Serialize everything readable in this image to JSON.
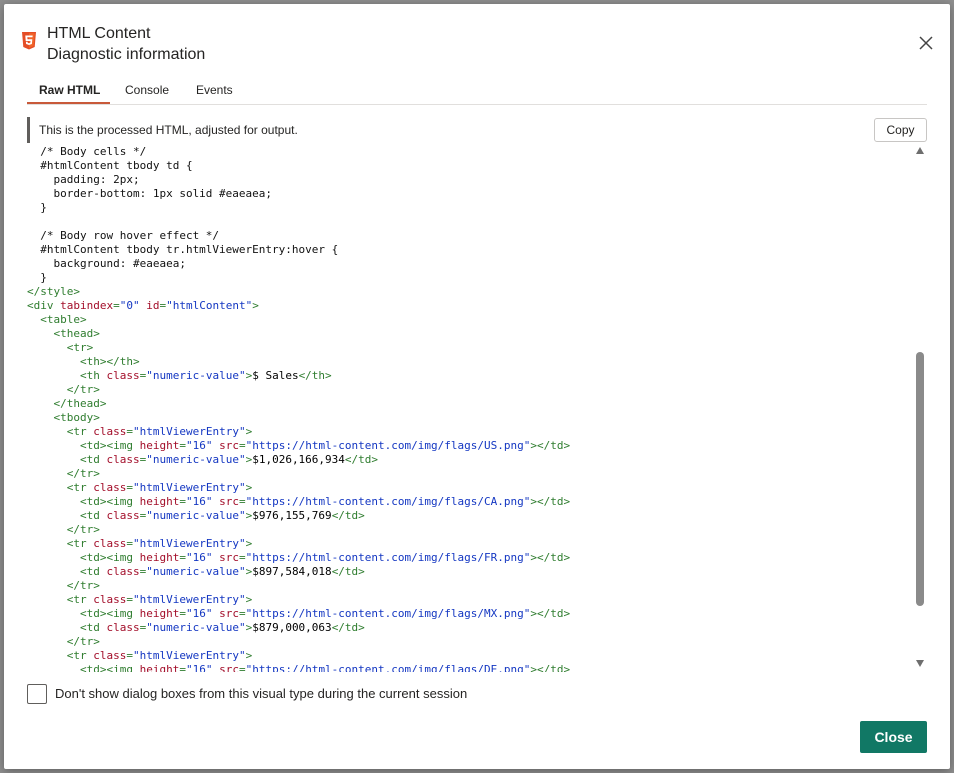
{
  "dialog": {
    "title_line1": "HTML Content",
    "title_line2": "Diagnostic information",
    "logo_icon": "html5-icon",
    "close_icon": "close-icon"
  },
  "tabs": [
    {
      "label": "Raw HTML",
      "active": true
    },
    {
      "label": "Console",
      "active": false
    },
    {
      "label": "Events",
      "active": false
    }
  ],
  "info_text": "This is the processed HTML, adjusted for output.",
  "copy_label": "Copy",
  "code_lines": [
    [
      [
        "c",
        "  /* Body cells */"
      ]
    ],
    [
      [
        "c",
        "  #htmlContent tbody td {"
      ]
    ],
    [
      [
        "c",
        "    padding: 2px;"
      ]
    ],
    [
      [
        "c",
        "    border-bottom: 1px solid #eaeaea;"
      ]
    ],
    [
      [
        "c",
        "  }"
      ]
    ],
    [
      [
        "c",
        ""
      ]
    ],
    [
      [
        "c",
        "  /* Body row hover effect */"
      ]
    ],
    [
      [
        "c",
        "  #htmlContent tbody tr.htmlViewerEntry:hover {"
      ]
    ],
    [
      [
        "c",
        "    background: #eaeaea;"
      ]
    ],
    [
      [
        "c",
        "  }"
      ]
    ],
    [
      [
        "t",
        "</style>"
      ]
    ],
    [
      [
        "t",
        "<div "
      ],
      [
        "a",
        "tabindex"
      ],
      [
        "t",
        "="
      ],
      [
        "v",
        "\"0\""
      ],
      [
        "t",
        " "
      ],
      [
        "a",
        "id"
      ],
      [
        "t",
        "="
      ],
      [
        "v",
        "\"htmlContent\""
      ],
      [
        "t",
        ">"
      ]
    ],
    [
      [
        "t",
        "  <table>"
      ]
    ],
    [
      [
        "t",
        "    <thead>"
      ]
    ],
    [
      [
        "t",
        "      <tr>"
      ]
    ],
    [
      [
        "t",
        "        <th></th>"
      ]
    ],
    [
      [
        "t",
        "        <th "
      ],
      [
        "a",
        "class"
      ],
      [
        "t",
        "="
      ],
      [
        "v",
        "\"numeric-value\""
      ],
      [
        "t",
        ">"
      ],
      [
        "tx",
        "$ Sales"
      ],
      [
        "t",
        "</th>"
      ]
    ],
    [
      [
        "t",
        "      </tr>"
      ]
    ],
    [
      [
        "t",
        "    </thead>"
      ]
    ],
    [
      [
        "t",
        "    <tbody>"
      ]
    ],
    [
      [
        "t",
        "      <tr "
      ],
      [
        "a",
        "class"
      ],
      [
        "t",
        "="
      ],
      [
        "v",
        "\"htmlViewerEntry\""
      ],
      [
        "t",
        ">"
      ]
    ],
    [
      [
        "t",
        "        <td><img "
      ],
      [
        "a",
        "height"
      ],
      [
        "t",
        "="
      ],
      [
        "v",
        "\"16\""
      ],
      [
        "t",
        " "
      ],
      [
        "a",
        "src"
      ],
      [
        "t",
        "="
      ],
      [
        "v",
        "\"https://html-content.com/img/flags/US.png\""
      ],
      [
        "t",
        "></td>"
      ]
    ],
    [
      [
        "t",
        "        <td "
      ],
      [
        "a",
        "class"
      ],
      [
        "t",
        "="
      ],
      [
        "v",
        "\"numeric-value\""
      ],
      [
        "t",
        ">"
      ],
      [
        "tx",
        "$1,026,166,934"
      ],
      [
        "t",
        "</td>"
      ]
    ],
    [
      [
        "t",
        "      </tr>"
      ]
    ],
    [
      [
        "t",
        "      <tr "
      ],
      [
        "a",
        "class"
      ],
      [
        "t",
        "="
      ],
      [
        "v",
        "\"htmlViewerEntry\""
      ],
      [
        "t",
        ">"
      ]
    ],
    [
      [
        "t",
        "        <td><img "
      ],
      [
        "a",
        "height"
      ],
      [
        "t",
        "="
      ],
      [
        "v",
        "\"16\""
      ],
      [
        "t",
        " "
      ],
      [
        "a",
        "src"
      ],
      [
        "t",
        "="
      ],
      [
        "v",
        "\"https://html-content.com/img/flags/CA.png\""
      ],
      [
        "t",
        "></td>"
      ]
    ],
    [
      [
        "t",
        "        <td "
      ],
      [
        "a",
        "class"
      ],
      [
        "t",
        "="
      ],
      [
        "v",
        "\"numeric-value\""
      ],
      [
        "t",
        ">"
      ],
      [
        "tx",
        "$976,155,769"
      ],
      [
        "t",
        "</td>"
      ]
    ],
    [
      [
        "t",
        "      </tr>"
      ]
    ],
    [
      [
        "t",
        "      <tr "
      ],
      [
        "a",
        "class"
      ],
      [
        "t",
        "="
      ],
      [
        "v",
        "\"htmlViewerEntry\""
      ],
      [
        "t",
        ">"
      ]
    ],
    [
      [
        "t",
        "        <td><img "
      ],
      [
        "a",
        "height"
      ],
      [
        "t",
        "="
      ],
      [
        "v",
        "\"16\""
      ],
      [
        "t",
        " "
      ],
      [
        "a",
        "src"
      ],
      [
        "t",
        "="
      ],
      [
        "v",
        "\"https://html-content.com/img/flags/FR.png\""
      ],
      [
        "t",
        "></td>"
      ]
    ],
    [
      [
        "t",
        "        <td "
      ],
      [
        "a",
        "class"
      ],
      [
        "t",
        "="
      ],
      [
        "v",
        "\"numeric-value\""
      ],
      [
        "t",
        ">"
      ],
      [
        "tx",
        "$897,584,018"
      ],
      [
        "t",
        "</td>"
      ]
    ],
    [
      [
        "t",
        "      </tr>"
      ]
    ],
    [
      [
        "t",
        "      <tr "
      ],
      [
        "a",
        "class"
      ],
      [
        "t",
        "="
      ],
      [
        "v",
        "\"htmlViewerEntry\""
      ],
      [
        "t",
        ">"
      ]
    ],
    [
      [
        "t",
        "        <td><img "
      ],
      [
        "a",
        "height"
      ],
      [
        "t",
        "="
      ],
      [
        "v",
        "\"16\""
      ],
      [
        "t",
        " "
      ],
      [
        "a",
        "src"
      ],
      [
        "t",
        "="
      ],
      [
        "v",
        "\"https://html-content.com/img/flags/MX.png\""
      ],
      [
        "t",
        "></td>"
      ]
    ],
    [
      [
        "t",
        "        <td "
      ],
      [
        "a",
        "class"
      ],
      [
        "t",
        "="
      ],
      [
        "v",
        "\"numeric-value\""
      ],
      [
        "t",
        ">"
      ],
      [
        "tx",
        "$879,000,063"
      ],
      [
        "t",
        "</td>"
      ]
    ],
    [
      [
        "t",
        "      </tr>"
      ]
    ],
    [
      [
        "t",
        "      <tr "
      ],
      [
        "a",
        "class"
      ],
      [
        "t",
        "="
      ],
      [
        "v",
        "\"htmlViewerEntry\""
      ],
      [
        "t",
        ">"
      ]
    ],
    [
      [
        "t",
        "        <td><img "
      ],
      [
        "a",
        "height"
      ],
      [
        "t",
        "="
      ],
      [
        "v",
        "\"16\""
      ],
      [
        "t",
        " "
      ],
      [
        "a",
        "src"
      ],
      [
        "t",
        "="
      ],
      [
        "v",
        "\"https://html-content.com/img/flags/DE.png\""
      ],
      [
        "t",
        "></td>"
      ]
    ]
  ],
  "checkbox": {
    "label": "Don't show dialog boxes from this visual type during the current session",
    "checked": false
  },
  "close_label": "Close",
  "colors": {
    "accent_underline": "#c8593a",
    "primary_button": "#117865",
    "code_tag": "#2f7d2f",
    "code_attr": "#a30e2a",
    "code_value": "#1437c2"
  }
}
